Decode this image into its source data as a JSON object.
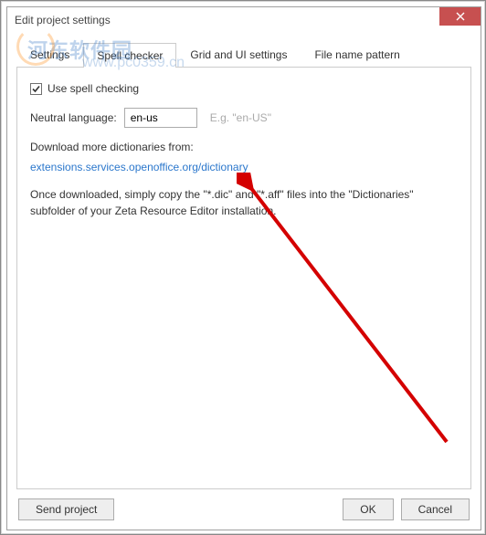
{
  "window": {
    "title": "Edit project settings"
  },
  "watermark": {
    "line1": "河东软件园",
    "line2": "www.pc0359.cn"
  },
  "tabs": [
    {
      "label": "Settings"
    },
    {
      "label": "Spell checker"
    },
    {
      "label": "Grid and UI settings"
    },
    {
      "label": "File name pattern"
    }
  ],
  "spell": {
    "use_label": "Use spell checking",
    "neutral_label": "Neutral language:",
    "neutral_value": "en-us",
    "neutral_hint": "E.g. \"en-US\"",
    "download_label": "Download more dictionaries from:",
    "download_link": "extensions.services.openoffice.org/dictionary",
    "instructions": "Once downloaded, simply copy the \"*.dic\" and \"*.aff\" files into the \"Dictionaries\" subfolder of your Zeta Resource Editor installation."
  },
  "buttons": {
    "send": "Send project",
    "ok": "OK",
    "cancel": "Cancel"
  }
}
